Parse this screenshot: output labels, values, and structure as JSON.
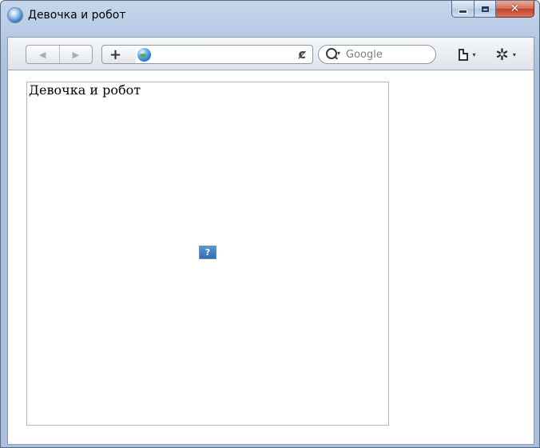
{
  "window": {
    "title": "Девочка и робот",
    "close_glyph": "✕"
  },
  "toolbar": {
    "back_glyph": "◀",
    "forward_glyph": "▶",
    "add_glyph": "+",
    "address_value": "",
    "reload_glyph": "ȼ",
    "search_placeholder": "Google",
    "gear_glyph": "✲",
    "dropdown_glyph": "▾"
  },
  "content": {
    "image_alt_text": "Девочка и робот",
    "broken_image_glyph": "?"
  },
  "icons": [
    "browser-app-icon",
    "globe-icon",
    "reload-icon",
    "search-icon",
    "page-icon",
    "gear-icon",
    "broken-image-icon"
  ],
  "colors": {
    "titlebar": "#c5d7ec",
    "close_button": "#c2412a",
    "viewport": "#ffffff"
  }
}
